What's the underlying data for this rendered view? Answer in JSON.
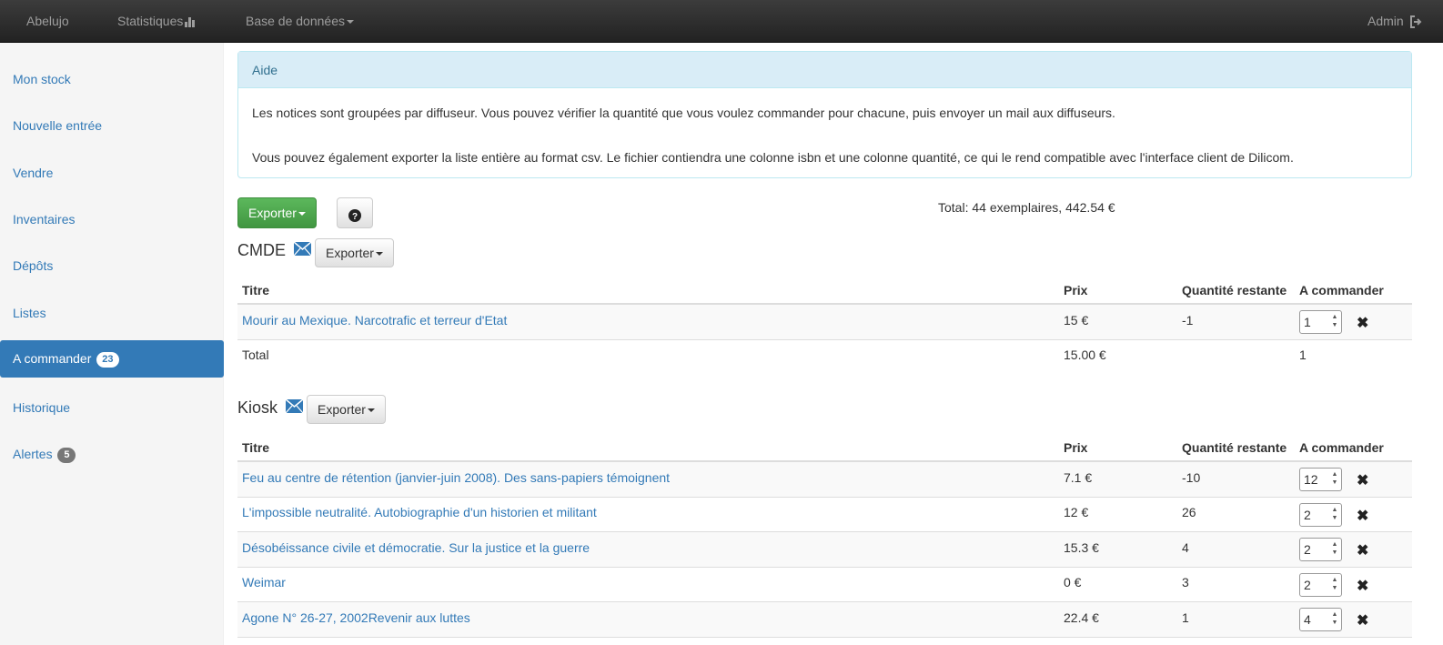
{
  "navbar": {
    "brand": "Abelujo",
    "stats": "Statistiques",
    "database": "Base de données",
    "user": "Admin"
  },
  "sidebar": {
    "items": [
      {
        "label": "Mon stock"
      },
      {
        "label": "Nouvelle entrée"
      },
      {
        "label": "Vendre"
      },
      {
        "label": "Inventaires"
      },
      {
        "label": "Dépôts"
      },
      {
        "label": "Listes"
      },
      {
        "label": "A commander",
        "badge": "23",
        "active": true
      },
      {
        "label": "Historique"
      },
      {
        "label": "Alertes",
        "badge": "5"
      }
    ]
  },
  "help": {
    "title": "Aide",
    "p1": "Les notices sont groupées par diffuseur. Vous pouvez vérifier la quantité que vous voulez commander pour chacune, puis envoyer un mail aux diffuseurs.",
    "p2": "Vous pouvez également exporter la liste entière au format csv. Le fichier contiendra une colonne isbn et une colonne quantité, ce qui le rend compatible avec l'interface client de Dilicom."
  },
  "toolbar": {
    "export_label": "Exporter",
    "help_button_icon": "question-circle-icon",
    "total": "Total: 44 exemplaires, 442.54 €"
  },
  "columns": {
    "title": "Titre",
    "price": "Prix",
    "remaining": "Quantité restante",
    "to_order": "A commander"
  },
  "groups": [
    {
      "name": "CMDE",
      "export_label": "Exporter",
      "rows": [
        {
          "title": "Mourir au Mexique. Narcotrafic et terreur d'Etat",
          "price": "15 €",
          "remaining": "-1",
          "qty": "1"
        }
      ],
      "total_label": "Total",
      "total_price": "15.00  €",
      "total_qty": "1"
    },
    {
      "name": "Kiosk",
      "export_label": "Exporter",
      "rows": [
        {
          "title": "Feu au centre de rétention (janvier-juin 2008). Des sans-papiers témoignent",
          "price": "7.1 €",
          "remaining": "-10",
          "qty": "12"
        },
        {
          "title": "L'impossible neutralité. Autobiographie d'un historien et militant",
          "price": "12 €",
          "remaining": "26",
          "qty": "2"
        },
        {
          "title": "Désobéissance civile et démocratie. Sur la justice et la guerre",
          "price": "15.3 €",
          "remaining": "4",
          "qty": "2"
        },
        {
          "title": "Weimar",
          "price": "0 €",
          "remaining": "3",
          "qty": "2"
        },
        {
          "title": "Agone N° 26-27, 2002Revenir aux luttes",
          "price": "22.4 €",
          "remaining": "1",
          "qty": "4"
        }
      ]
    }
  ],
  "colors": {
    "primary": "#337ab7",
    "success": "#5cb85c",
    "info_bg": "#d9edf7"
  }
}
